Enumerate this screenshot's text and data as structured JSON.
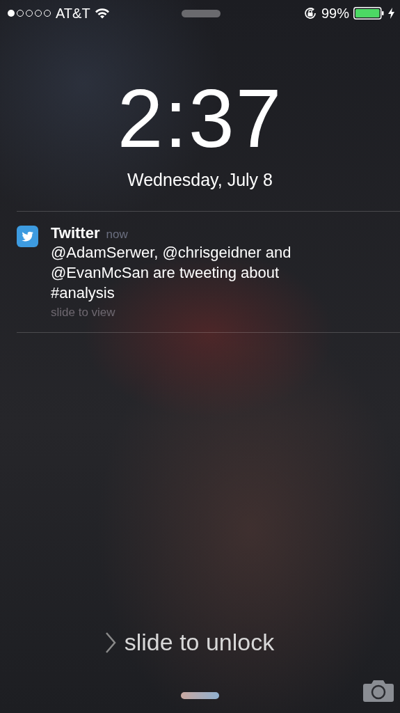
{
  "status_bar": {
    "carrier": "AT&T",
    "battery": "99%"
  },
  "clock": {
    "time": "2:37",
    "date": "Wednesday, July 8"
  },
  "notifications": [
    {
      "app": "Twitter",
      "time": "now",
      "message": "@AdamSerwer, @chrisgeidner and @EvanMcSan are tweeting about #analysis",
      "action": "slide to view"
    }
  ],
  "unlock": {
    "label": "slide to unlock"
  }
}
